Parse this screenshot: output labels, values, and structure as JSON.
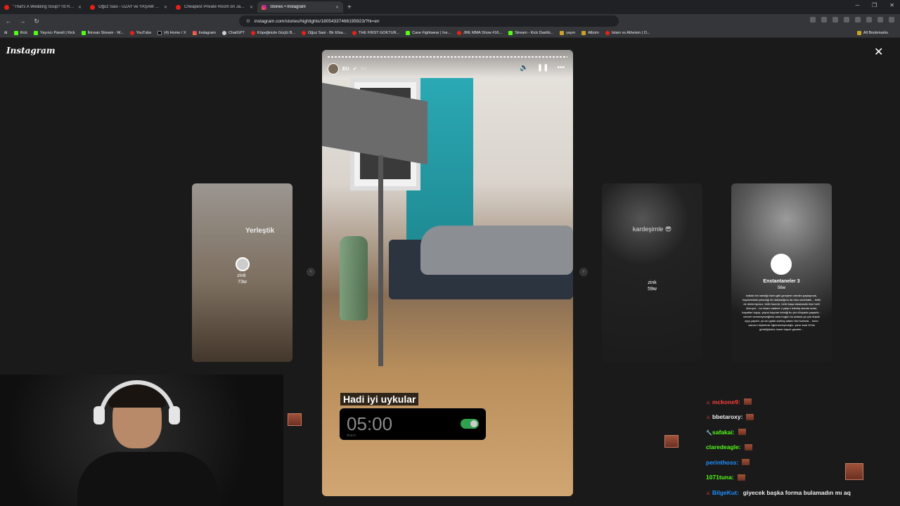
{
  "browser": {
    "tabs": [
      {
        "title": "\"That's A Wedding Soup? I'd Rather",
        "favicon": "youtube-icon",
        "active": false
      },
      {
        "title": "Oğuz Sasi - UZAY ve YAŞAM Teoriler",
        "favicon": "youtube-icon",
        "active": false
      },
      {
        "title": "Cheapest Private Room on Japan's Ch",
        "favicon": "youtube-icon",
        "active": false
      },
      {
        "title": "Stories • Instagram",
        "favicon": "instagram-icon",
        "active": true
      }
    ],
    "url": "instagram.com/stories/highlights/18054337466195923/?hl=en",
    "bookmarks": [
      {
        "label": "Kick",
        "icon": "kick-icon"
      },
      {
        "label": "Yayıncı Paneli | Kick",
        "icon": "kick-icon"
      },
      {
        "label": "İkinsan Stream - W...",
        "icon": "kick-icon"
      },
      {
        "label": "YouTube",
        "icon": "youtube-icon"
      },
      {
        "label": "(4) Home / X",
        "icon": "x-icon"
      },
      {
        "label": "Instagram",
        "icon": "instagram-icon"
      },
      {
        "label": "ChatGPT",
        "icon": "chatgpt-icon"
      },
      {
        "label": "Köpeğinizle Güçlü B...",
        "icon": "youtube-icon"
      },
      {
        "label": "Oğuz Sasi - Bir Efsa...",
        "icon": "youtube-icon"
      },
      {
        "label": "THE FIRST GOKTUR...",
        "icon": "youtube-icon"
      },
      {
        "label": "Cave Fightwear | Ins...",
        "icon": "leaf-icon"
      },
      {
        "label": "JRE MMA Show #16...",
        "icon": "youtube-icon"
      },
      {
        "label": "Stream - Kick Dashb...",
        "icon": "kick-icon"
      },
      {
        "label": "yayın",
        "icon": "folder-icon"
      },
      {
        "label": "Albüm",
        "icon": "folder-icon"
      },
      {
        "label": "Islam vs Atheism | O...",
        "icon": "youtube-icon"
      }
    ],
    "all_bookmarks": "All Bookmarks"
  },
  "instagram": {
    "logo": "Instagram",
    "main_story": {
      "username": "EU",
      "time": "2w",
      "caption": "Hadi iyi uykular",
      "alarm_time": "05:00",
      "alarm_label": "Alarm"
    },
    "side_stories": {
      "left": {
        "overlay_text": "Yerleştik",
        "username": "zink",
        "time": "73w"
      },
      "right1": {
        "overlay_text": "kardeşimle 😎",
        "username": "zink",
        "time": "59w"
      },
      "right2": {
        "title": "Enstantaneler 3",
        "time": "56w",
        "body": "hallaki tek istediği bizim gibi gençlerin derdini paylaşmak, hayatımdaki yalnızlığı iki dakikalığına da olsa unutmaktı... belki de dinlemiyoruz, belki hazırdı, belki başa takamadık bize belli olmuyor... bu insanı sadece o yaşını izlemiş olanlar anlar, hayatları kayıp, yaşını kaçıran tekniği bu yer dünyada yaşadık... ceremi veremeyeceğimiz ama bugün bu adama ya çok düşük ayıp yapıldı, ya da çıplak sarhoş adamı bizi kurtardı... bunu sanırım hiçbirimiz öğrenemeyeceğiz. yarın saat 10'da gördüğümüz üzere hayırlı geceler..."
      }
    }
  },
  "chat": [
    {
      "user": "mckone9:",
      "color": "#ff3c3c",
      "badge": "sword",
      "message": ""
    },
    {
      "user": "bbetaroxy:",
      "color": "#efeff1",
      "badge": "sword",
      "message": ""
    },
    {
      "user": "safakai:",
      "color": "#53fc18",
      "badge": "wrench",
      "message": ""
    },
    {
      "user": "claredeagle:",
      "color": "#53fc18",
      "badge": "",
      "message": ""
    },
    {
      "user": "perinthoss:",
      "color": "#1e90ff",
      "badge": "",
      "message": ""
    },
    {
      "user": "1071tuna:",
      "color": "#53fc18",
      "badge": "",
      "message": ""
    },
    {
      "user": "BilgeKut:",
      "color": "#1e90ff",
      "badge": "sword",
      "message": "giyecek başka forma bulamadın mı aq"
    }
  ]
}
